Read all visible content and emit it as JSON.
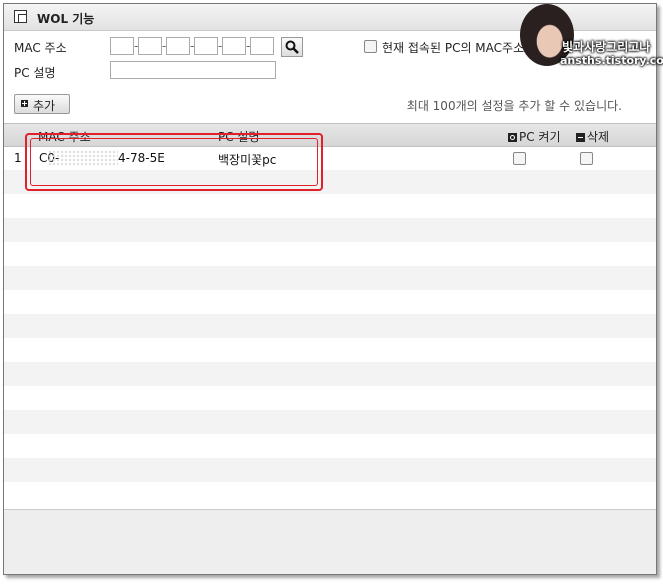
{
  "window": {
    "title": "WOL 기능"
  },
  "form": {
    "mac_label": "MAC 주소",
    "pc_desc_label": "PC 설명",
    "current_pc_mac_label": "현재 접속된 PC의 MAC주소",
    "add_label": "추가",
    "limit_note": "최대 100개의 설정을 추가 할 수 있습니다."
  },
  "table": {
    "headers": {
      "mac": "MAC 주소",
      "desc": "PC 설명",
      "power_on": "PC 켜기",
      "delete": "삭제"
    },
    "rows": [
      {
        "index": "1",
        "mac_prefix": "C0-",
        "mac_suffix": "4-78-5E",
        "desc": "백장미꽃pc"
      }
    ]
  },
  "watermark": {
    "line1": "빛과사랑그리고나",
    "line2": "ansths.tistory.com"
  }
}
